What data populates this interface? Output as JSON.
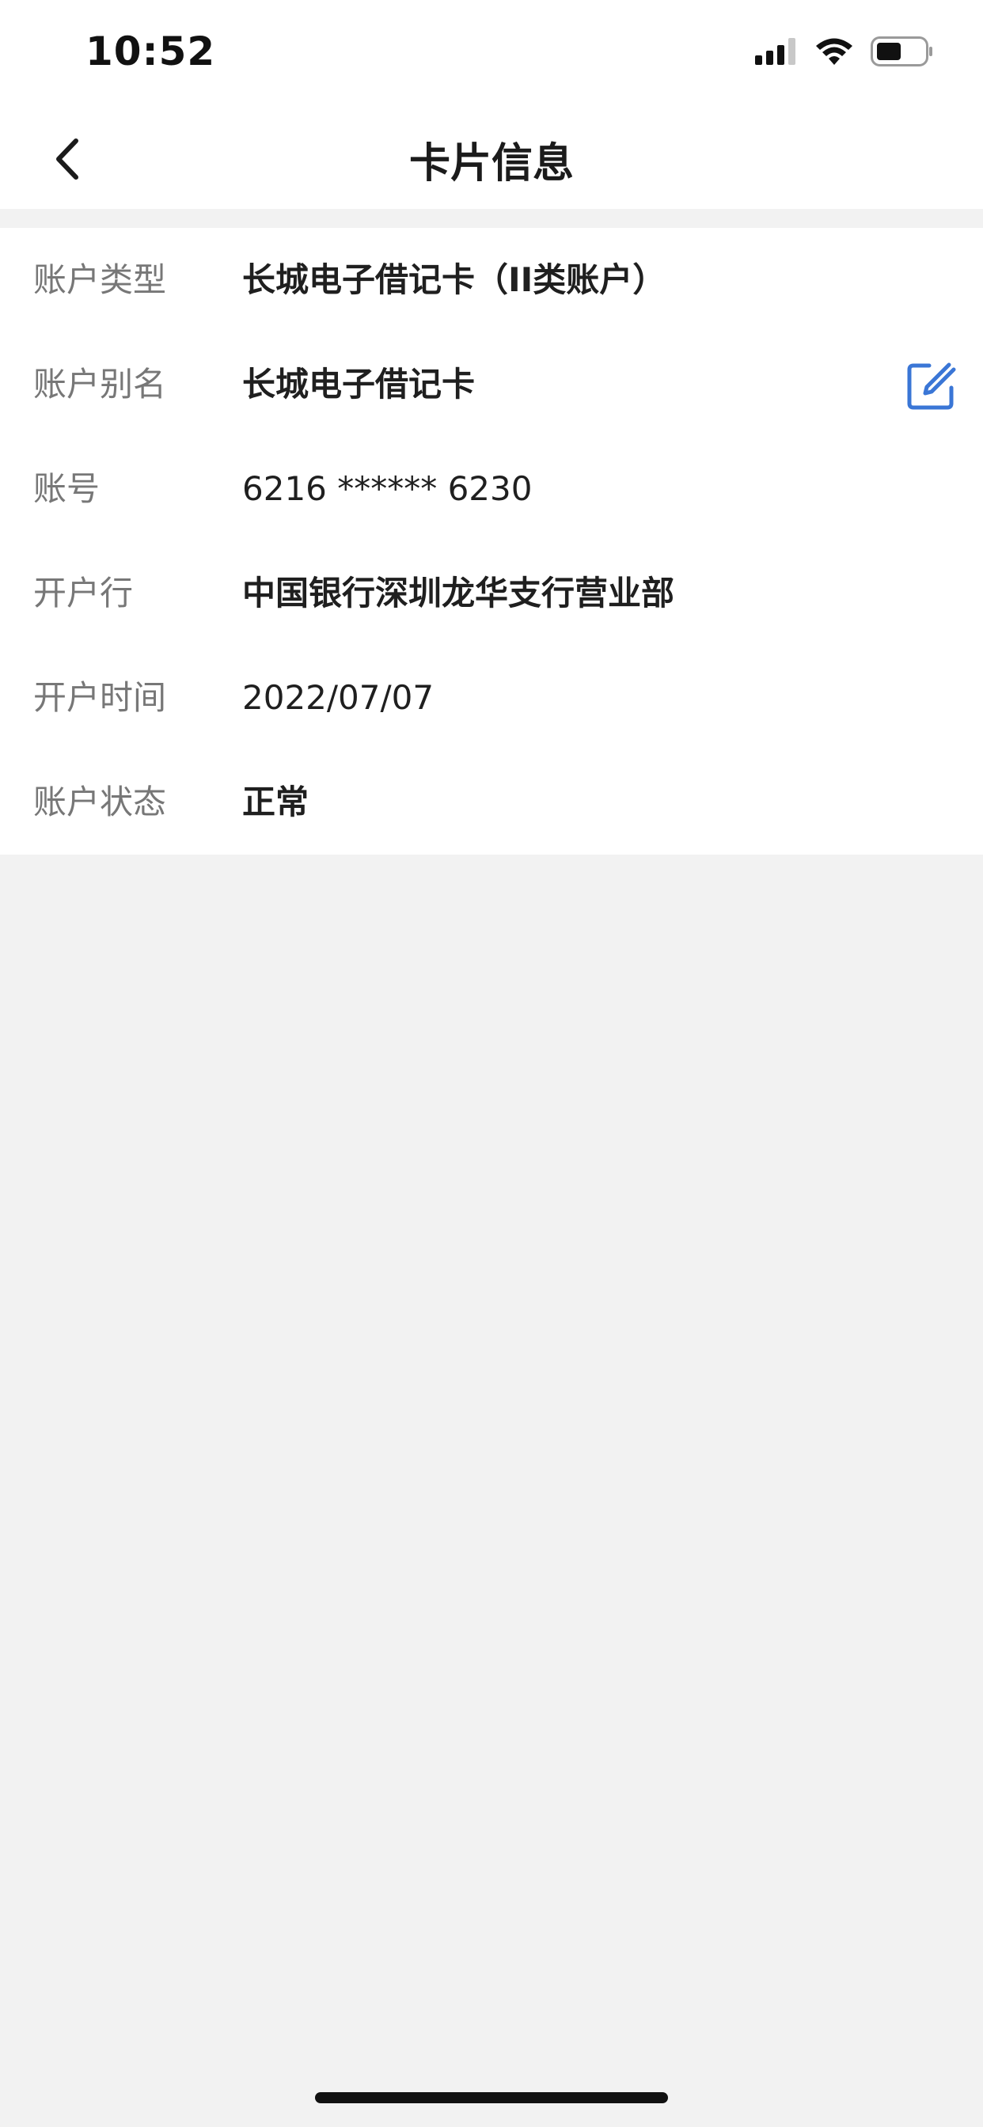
{
  "status_bar": {
    "time": "10:52",
    "icons": [
      "signal-icon",
      "wifi-icon",
      "battery-icon"
    ]
  },
  "header": {
    "title": "卡片信息",
    "back_icon": "chevron-left-icon"
  },
  "card_info": {
    "account_type_label": "账户类型",
    "account_type_value": "长城电子借记卡（II类账户）",
    "account_alias_label": "账户别名",
    "account_alias_value": "长城电子借记卡",
    "account_number_label": "账号",
    "account_number_value": "6216 ****** 6230",
    "opening_bank_label": "开户行",
    "opening_bank_value": "中国银行深圳龙华支行营业部",
    "opening_time_label": "开户时间",
    "opening_time_value": "2022/07/07",
    "account_status_label": "账户状态",
    "account_status_value": "正常",
    "edit_icon": "edit-icon"
  },
  "colors": {
    "accent": "#3a76d6",
    "background": "#f2f2f2",
    "surface": "#ffffff",
    "label_text": "#777777",
    "value_text": "#1f1f1f"
  }
}
